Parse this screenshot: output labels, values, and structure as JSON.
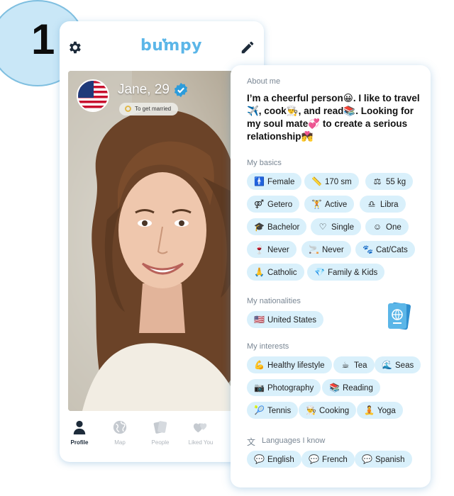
{
  "step": "1",
  "app": {
    "logo": "bumpy"
  },
  "profile": {
    "name_age": "Jane, 29",
    "goal": "To get married",
    "country_flag_icon": "us-flag-icon"
  },
  "tabs": [
    {
      "label": "Profile",
      "icon": "person-icon",
      "active": true
    },
    {
      "label": "Map",
      "icon": "globe-icon",
      "active": false
    },
    {
      "label": "People",
      "icon": "cards-icon",
      "active": false
    },
    {
      "label": "Liked You",
      "icon": "hearts-icon",
      "active": false
    }
  ],
  "about": {
    "label": "About me",
    "text": "I’m a cheerful person😀. I like to travel✈️, cook👨‍🍳, and read📚. Looking for my soul mate💞 to create a serious relationship💏"
  },
  "basics": {
    "label": "My basics",
    "chips": [
      {
        "icon": "🚹",
        "text": "Female"
      },
      {
        "icon": "📏",
        "text": "170 sm"
      },
      {
        "icon": "⚖",
        "text": "55 kg"
      },
      {
        "icon": "⚤",
        "text": "Getero"
      },
      {
        "icon": "🏋",
        "text": "Active"
      },
      {
        "icon": "♎",
        "text": "Libra"
      },
      {
        "icon": "🎓",
        "text": "Bachelor"
      },
      {
        "icon": "♡",
        "text": "Single"
      },
      {
        "icon": "☺",
        "text": "One"
      },
      {
        "icon": "🍷",
        "text": "Never"
      },
      {
        "icon": "🚬",
        "text": "Never"
      },
      {
        "icon": "🐾",
        "text": "Cat/Cats"
      },
      {
        "icon": "🙏",
        "text": "Catholic"
      },
      {
        "icon": "💎",
        "text": "Family & Kids"
      }
    ]
  },
  "nationalities": {
    "label": "My nationalities",
    "chips": [
      {
        "icon": "🇺🇸",
        "text": "United States"
      }
    ]
  },
  "interests": {
    "label": "My interests",
    "chips": [
      {
        "icon": "💪",
        "text": "Healthy lifestyle"
      },
      {
        "icon": "☕",
        "text": "Tea"
      },
      {
        "icon": "🌊",
        "text": "Seas"
      },
      {
        "icon": "📷",
        "text": "Photography"
      },
      {
        "icon": "📚",
        "text": "Reading"
      },
      {
        "icon": "🎾",
        "text": "Tennis"
      },
      {
        "icon": "👨‍🍳",
        "text": "Cooking"
      },
      {
        "icon": "🧘",
        "text": "Yoga"
      }
    ]
  },
  "languages": {
    "label": "Languages I know",
    "chips": [
      {
        "icon": "💬",
        "text": "English"
      },
      {
        "icon": "💬",
        "text": "French"
      },
      {
        "icon": "💬",
        "text": "Spanish"
      }
    ]
  },
  "colors": {
    "accent": "#5bb6e8",
    "chip_bg": "#d9f0fb",
    "step_bg": "#c9e7f7"
  }
}
